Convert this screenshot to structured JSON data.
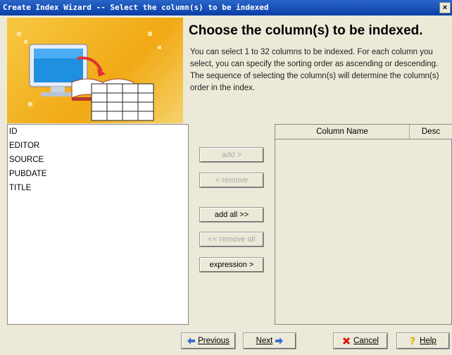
{
  "window": {
    "title": "Create Index Wizard -- Select the column(s) to be indexed",
    "close_glyph": "×"
  },
  "header": {
    "heading": "Choose the column(s) to be indexed.",
    "description": "You can select 1 to 32 columns to be indexed. For each column you select, you can specify the sorting order as ascending or descending. The sequence of selecting the column(s) will determine the column(s) order in the index."
  },
  "available_columns": [
    "ID",
    "EDITOR",
    "SOURCE",
    "PUBDATE",
    "TITLE"
  ],
  "middle_buttons": {
    "add": "add >",
    "remove": "< remove",
    "add_all": "add all >>",
    "remove_all": "<< remove all",
    "expression": "expression >"
  },
  "selected_table": {
    "columns": [
      "Column Name",
      "Desc"
    ]
  },
  "footer": {
    "previous": "Previous",
    "next": "Next",
    "cancel": "Cancel",
    "help": "Help"
  },
  "icons": [
    "wizard-illustration",
    "left-arrow-icon",
    "right-arrow-icon",
    "cancel-x-icon",
    "help-question-icon"
  ],
  "colors": {
    "title_bar": "#0a3ea8",
    "banner": "#f1a914",
    "background": "#ece9d8"
  }
}
